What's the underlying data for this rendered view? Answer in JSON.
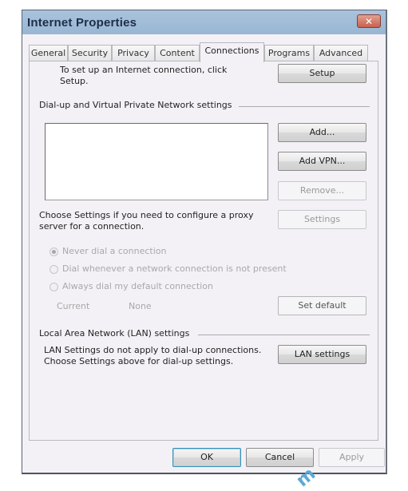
{
  "window": {
    "title": "Internet Properties",
    "close_glyph": "✕"
  },
  "tabs": [
    {
      "label": "General",
      "active": false
    },
    {
      "label": "Security",
      "active": false
    },
    {
      "label": "Privacy",
      "active": false
    },
    {
      "label": "Content",
      "active": false
    },
    {
      "label": "Connections",
      "active": true
    },
    {
      "label": "Programs",
      "active": false
    },
    {
      "label": "Advanced",
      "active": false
    }
  ],
  "connections": {
    "setup_text": "To set up an Internet connection, click Setup.",
    "setup_button": "Setup",
    "dialup_group_label": "Dial-up and Virtual Private Network settings",
    "dialup_list_items": [],
    "add_button": "Add...",
    "add_vpn_button": "Add VPN...",
    "remove_button": "Remove...",
    "proxy_text": "Choose Settings if you need to configure a proxy server for a connection.",
    "settings_button": "Settings",
    "radio_options": [
      {
        "label": "Never dial a connection",
        "checked": true
      },
      {
        "label": "Dial whenever a network connection is not present",
        "checked": false
      },
      {
        "label": "Always dial my default connection",
        "checked": false
      }
    ],
    "current_label": "Current",
    "current_value": "None",
    "set_default_button": "Set default",
    "lan_group_label": "Local Area Network (LAN) settings",
    "lan_text": "LAN Settings do not apply to dial-up connections. Choose Settings above for dial-up settings.",
    "lan_settings_button": "LAN settings"
  },
  "footer": {
    "ok_button": "OK",
    "cancel_button": "Cancel",
    "apply_button": "Apply"
  },
  "watermark_text": "m"
}
